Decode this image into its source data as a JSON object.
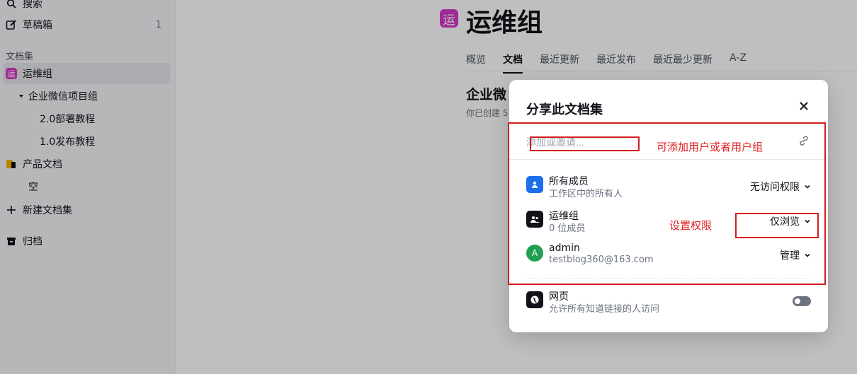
{
  "sidebar": {
    "search_label": "搜索",
    "drafts": {
      "label": "草稿箱",
      "count": "1"
    },
    "section_label": "文档集",
    "items": [
      {
        "label": "运维组",
        "badge": "运",
        "active": true
      },
      {
        "label": "企业微信项目组"
      },
      {
        "label": "2.0部署教程"
      },
      {
        "label": "1.0发布教程"
      },
      {
        "label": "产品文档"
      },
      {
        "label": "空"
      }
    ],
    "new_collection": "新建文档集",
    "archive": "归档"
  },
  "main": {
    "badge": "运",
    "title": "运维组",
    "tabs": [
      "概览",
      "文档",
      "最近更新",
      "最近发布",
      "最近最少更新",
      "A-Z"
    ],
    "active_tab": "文档",
    "subtitle": "企业微",
    "desc": "你已创建 5"
  },
  "modal": {
    "title": "分享此文档集",
    "input_placeholder": "添加或邀请...",
    "members": [
      {
        "name": "所有成员",
        "sub": "工作区中的所有人",
        "permission": "无访问权限",
        "avatar_color": "#1f6feb"
      },
      {
        "name": "运维组",
        "sub": "0 位成员",
        "permission": "仅浏览",
        "avatar_color": "#111319"
      },
      {
        "name": "admin",
        "sub": "testblog360@163.com",
        "permission": "管理",
        "avatar_letter": "A",
        "avatar_color": "#21a054"
      }
    ],
    "web": {
      "name": "网页",
      "sub": "允许所有知道链接的人访问",
      "enabled": false
    }
  },
  "annotations": {
    "add_users": "可添加用户或者用户组",
    "set_permission": "设置权限",
    "color": "#e02020"
  }
}
